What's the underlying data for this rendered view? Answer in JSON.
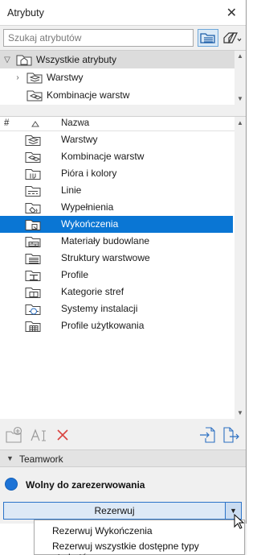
{
  "window": {
    "title": "Atrybuty",
    "close_glyph": "✕"
  },
  "search": {
    "placeholder": "Szukaj atrybutów"
  },
  "toolbar": {
    "icons": [
      "folder-view-icon",
      "tag-filter-icon"
    ]
  },
  "tree": {
    "items": [
      {
        "label": "Wszystkie atrybuty",
        "expanded": true,
        "icon": "all-attributes-icon"
      },
      {
        "label": "Warstwy",
        "expanded": false,
        "icon": "layers-icon"
      },
      {
        "label": "Kombinacje warstw",
        "icon": "layer-combinations-icon"
      }
    ]
  },
  "list": {
    "columns": [
      "#",
      "Nazwa"
    ],
    "selected_index": 5,
    "rows": [
      {
        "label": "Warstwy",
        "icon": "layers-icon"
      },
      {
        "label": "Kombinacje warstw",
        "icon": "layer-combinations-icon"
      },
      {
        "label": "Pióra i kolory",
        "icon": "pens-colors-icon"
      },
      {
        "label": "Linie",
        "icon": "lines-icon"
      },
      {
        "label": "Wypełnienia",
        "icon": "fills-icon"
      },
      {
        "label": "Wykończenia",
        "icon": "surfaces-icon"
      },
      {
        "label": "Materiały budowlane",
        "icon": "building-materials-icon"
      },
      {
        "label": "Struktury warstwowe",
        "icon": "composites-icon"
      },
      {
        "label": "Profile",
        "icon": "profiles-icon"
      },
      {
        "label": "Kategorie stref",
        "icon": "zone-categories-icon"
      },
      {
        "label": "Systemy instalacji",
        "icon": "mep-systems-icon"
      },
      {
        "label": "Profile użytkowania",
        "icon": "operation-profiles-icon"
      }
    ]
  },
  "bottom_tools": [
    "new-attribute-icon",
    "rename-icon",
    "delete-icon",
    "import-icon",
    "export-icon"
  ],
  "teamwork": {
    "section_label": "Teamwork",
    "status_text": "Wolny do zarezerwowania",
    "status_color": "#1d73d6",
    "reserve_button": "Rezerwuj",
    "menu_items": [
      "Rezerwuj Wykończenia",
      "Rezerwuj wszystkie dostępne typy atrybutów."
    ]
  },
  "colors": {
    "selection": "#0a76d4",
    "accent": "#2b73c8",
    "delete_red": "#d9433f"
  }
}
